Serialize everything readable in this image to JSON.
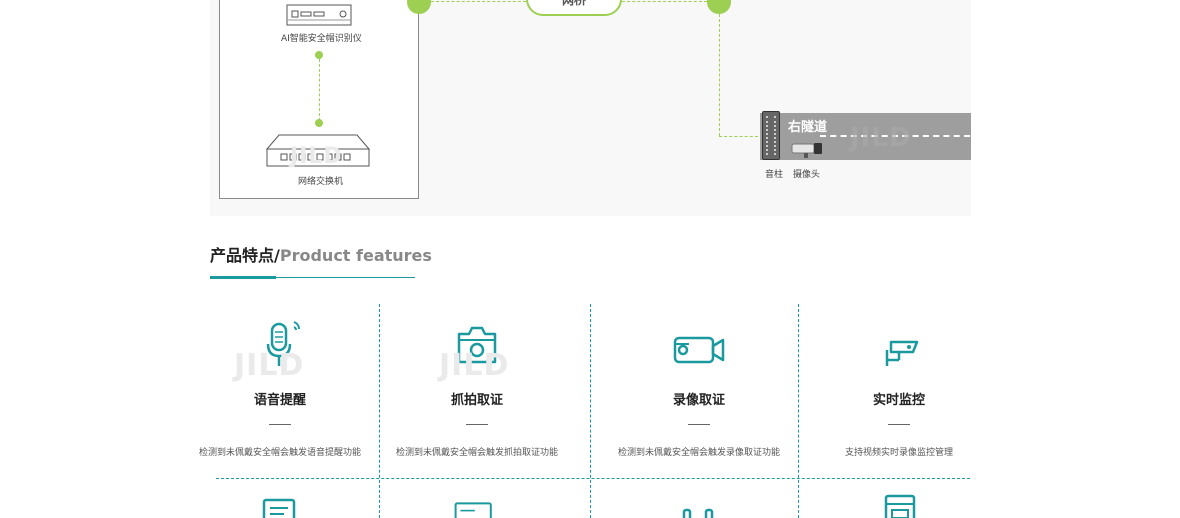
{
  "diagram": {
    "device_label": "AI智能安全帽识别仪",
    "switch_label": "网络交换机",
    "net_label": "网桥",
    "tunnel_label": "右隧道",
    "pillar_label": "音柱",
    "camera_label": "摄像头",
    "watermark": "JILD"
  },
  "features": {
    "title_cn": "产品特点/",
    "title_en": "Product features",
    "cards": [
      {
        "icon": "microphone-icon",
        "title": "语音提醒",
        "desc": "检测到未佩戴安全帽会触发语音提醒功能"
      },
      {
        "icon": "camera-icon",
        "title": "抓拍取证",
        "desc": "检测到未佩戴安全帽会触发抓拍取证功能"
      },
      {
        "icon": "video-camera-icon",
        "title": "录像取证",
        "desc": "检测到未佩戴安全帽会触发录像取证功能"
      },
      {
        "icon": "cctv-icon",
        "title": "实时监控",
        "desc": "支持视频实时录像监控管理"
      }
    ]
  },
  "colors": {
    "accent": "#1a9a9f",
    "line": "#9ccf52"
  }
}
